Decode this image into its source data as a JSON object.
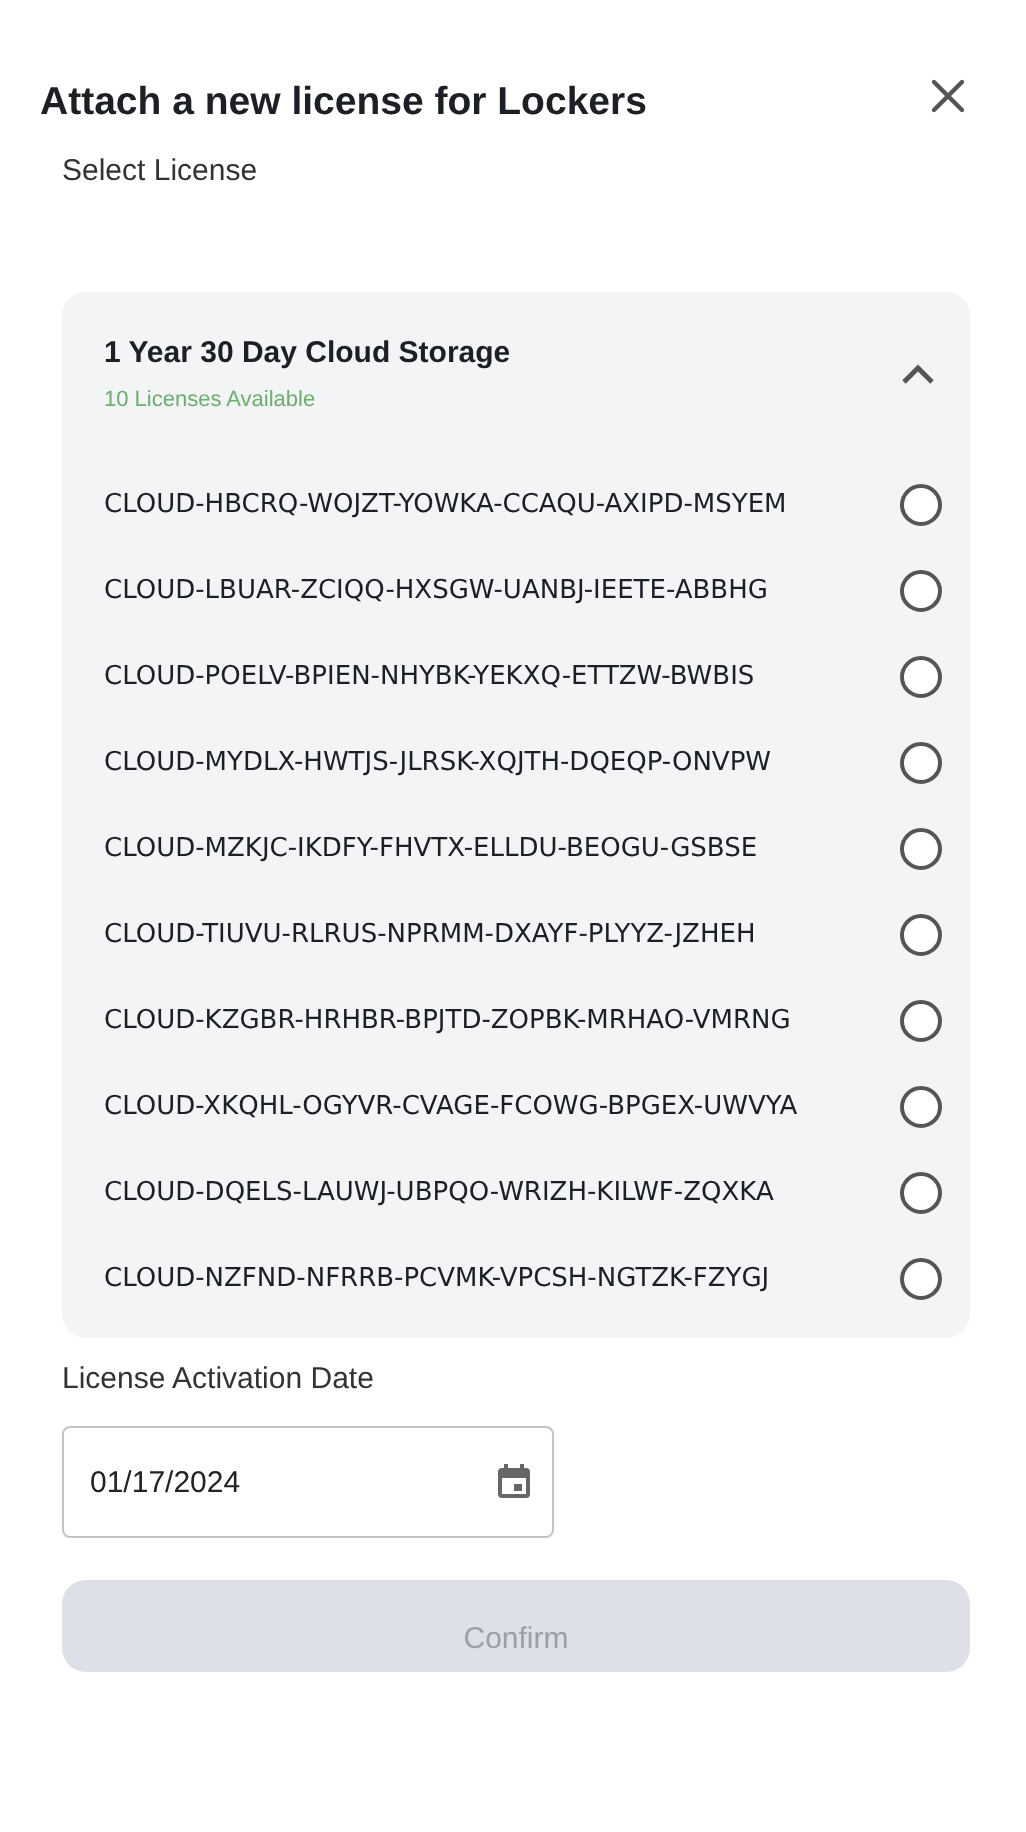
{
  "dialog": {
    "title": "Attach a new license for Lockers"
  },
  "select_label": "Select License",
  "license_group": {
    "title": "1 Year 30 Day Cloud Storage",
    "subtitle": "10 Licenses Available",
    "expanded": true,
    "licenses": [
      {
        "code": "CLOUD-HBCRQ-WOJZT-YOWKA-CCAQU-AXIPD-MSYEM",
        "selected": false
      },
      {
        "code": "CLOUD-LBUAR-ZCIQQ-HXSGW-UANBJ-IEETE-ABBHG",
        "selected": false
      },
      {
        "code": "CLOUD-POELV-BPIEN-NHYBK-YEKXQ-ETTZW-BWBIS",
        "selected": false
      },
      {
        "code": "CLOUD-MYDLX-HWTJS-JLRSK-XQJTH-DQEQP-ONVPW",
        "selected": false
      },
      {
        "code": "CLOUD-MZKJC-IKDFY-FHVTX-ELLDU-BEOGU-GSBSE",
        "selected": false
      },
      {
        "code": "CLOUD-TIUVU-RLRUS-NPRMM-DXAYF-PLYYZ-JZHEH",
        "selected": false
      },
      {
        "code": "CLOUD-KZGBR-HRHBR-BPJTD-ZOPBK-MRHAO-VMRNG",
        "selected": false
      },
      {
        "code": "CLOUD-XKQHL-OGYVR-CVAGE-FCOWG-BPGEX-UWVYA",
        "selected": false
      },
      {
        "code": "CLOUD-DQELS-LAUWJ-UBPQO-WRIZH-KILWF-ZQXKA",
        "selected": false
      },
      {
        "code": "CLOUD-NZFND-NFRRB-PCVMK-VPCSH-NGTZK-FZYGJ",
        "selected": false
      }
    ]
  },
  "activation_date": {
    "label": "License Activation Date",
    "value": "01/17/2024"
  },
  "confirm": {
    "label": "Confirm",
    "disabled": true
  }
}
